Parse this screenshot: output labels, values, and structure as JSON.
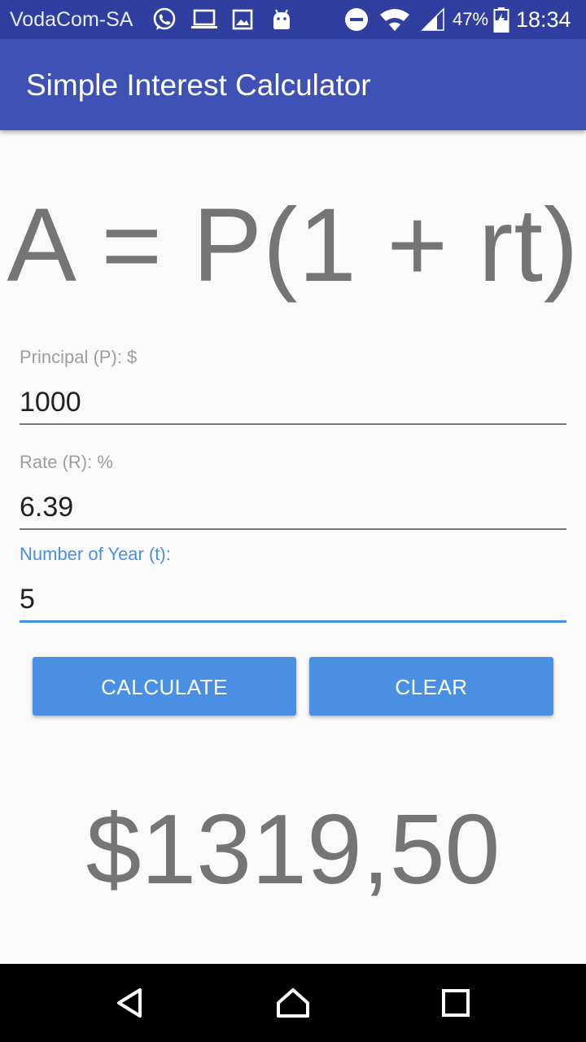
{
  "status_bar": {
    "carrier": "VodaCom-SA",
    "battery": "47%",
    "time": "18:34",
    "icons": [
      "whatsapp-icon",
      "laptop-icon",
      "image-icon",
      "android-icon",
      "dnd-icon",
      "wifi-icon",
      "signal-icon",
      "battery-icon"
    ]
  },
  "app_bar": {
    "title": "Simple Interest Calculator"
  },
  "formula": "A = P(1 + rt)",
  "fields": {
    "principal": {
      "label": "Principal (P): $",
      "value": "1000"
    },
    "rate": {
      "label": "Rate (R): %",
      "value": "6.39"
    },
    "years": {
      "label": "Number of Year (t):",
      "value": "5"
    }
  },
  "buttons": {
    "calculate": "CALCULATE",
    "clear": "CLEAR"
  },
  "result": "$1319,50",
  "colors": {
    "status_bar": "#303f9f",
    "app_bar": "#3f51b5",
    "accent": "#4a90e2",
    "text_gray": "#757575"
  },
  "nav_bar": {
    "icons": [
      "back-icon",
      "home-icon",
      "recents-icon"
    ]
  }
}
